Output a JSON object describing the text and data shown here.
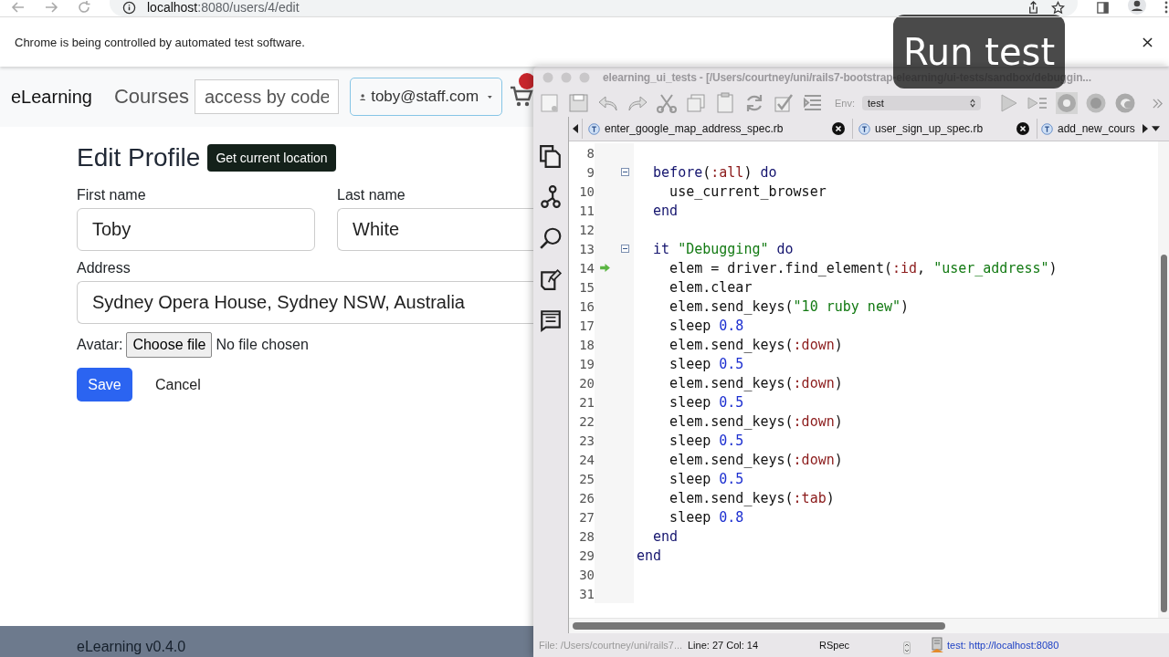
{
  "browser": {
    "url_host": "localhost",
    "url_rest": ":8080/users/4/edit",
    "infobar": "Chrome is being controlled by automated test software."
  },
  "site": {
    "brand": "eLearning",
    "nav_link": "Courses",
    "code_field": {
      "placeholder": "access by code"
    },
    "user_menu": "toby@staff.com"
  },
  "form": {
    "title": "Edit Profile",
    "location_button": "Get current location",
    "fields": [
      {
        "label": "First name",
        "value": "Toby"
      },
      {
        "label": "Last name",
        "value": "White"
      },
      {
        "label": "Address",
        "value": "Sydney Opera House, Sydney NSW, Australia"
      }
    ],
    "avatar_label": "Avatar:",
    "file_button": "Choose file",
    "file_status": "No file chosen",
    "save": "Save",
    "cancel": "Cancel"
  },
  "footer": "eLearning v0.4.0",
  "ide": {
    "title": "elearning_ui_tests - [/Users/courtney/uni/rails7-bootstrap-elearning/ui-tests/sandbox/debuggin...",
    "env_label": "Env:",
    "env_value": "test",
    "tabs": [
      {
        "label": "enter_google_map_address_spec.rb",
        "closable": true
      },
      {
        "label": "user_sign_up_spec.rb",
        "closable": true
      },
      {
        "label": "add_new_cours",
        "closable": false
      }
    ],
    "lines": [
      {
        "n": "8",
        "fold": false,
        "current": false
      },
      {
        "n": "9",
        "fold": true,
        "current": false,
        "tokens": [
          {
            "kind": "keyword",
            "text": "  before"
          },
          {
            "kind": "plain",
            "text": "("
          },
          {
            "kind": "symbol",
            "text": ":all"
          },
          {
            "kind": "plain",
            "text": ") "
          },
          {
            "kind": "keyword",
            "text": "do"
          }
        ]
      },
      {
        "n": "10",
        "fold": false,
        "current": false,
        "tokens": [
          {
            "kind": "plain",
            "text": "    use_current_browser"
          }
        ]
      },
      {
        "n": "11",
        "fold": false,
        "current": false,
        "tokens": [
          {
            "kind": "keyword",
            "text": "  end"
          }
        ]
      },
      {
        "n": "12",
        "fold": false,
        "current": false
      },
      {
        "n": "13",
        "fold": true,
        "current": false,
        "tokens": [
          {
            "kind": "keyword",
            "text": "  it"
          },
          {
            "kind": "string",
            "text": " \"Debugging\""
          },
          {
            "kind": "keyword",
            "text": " do"
          }
        ]
      },
      {
        "n": "14",
        "fold": false,
        "current": true,
        "tokens": [
          {
            "kind": "plain",
            "text": "    elem = driver.find_element("
          },
          {
            "kind": "symbol",
            "text": ":id"
          },
          {
            "kind": "plain",
            "text": ", "
          },
          {
            "kind": "string",
            "text": "\"user_address\""
          },
          {
            "kind": "plain",
            "text": ")"
          }
        ]
      },
      {
        "n": "15",
        "fold": false,
        "current": false,
        "tokens": [
          {
            "kind": "plain",
            "text": "    elem.clear"
          }
        ]
      },
      {
        "n": "16",
        "fold": false,
        "current": false,
        "tokens": [
          {
            "kind": "plain",
            "text": "    elem.send_keys("
          },
          {
            "kind": "string",
            "text": "\"10 ruby new\""
          },
          {
            "kind": "plain",
            "text": ")"
          }
        ]
      },
      {
        "n": "17",
        "fold": false,
        "current": false,
        "tokens": [
          {
            "kind": "plain",
            "text": "    sleep "
          },
          {
            "kind": "number",
            "text": "0.8"
          }
        ]
      },
      {
        "n": "18",
        "fold": false,
        "current": false,
        "tokens": [
          {
            "kind": "plain",
            "text": "    elem.send_keys("
          },
          {
            "kind": "symbol",
            "text": ":down"
          },
          {
            "kind": "plain",
            "text": ")"
          }
        ]
      },
      {
        "n": "19",
        "fold": false,
        "current": false,
        "tokens": [
          {
            "kind": "plain",
            "text": "    sleep "
          },
          {
            "kind": "number",
            "text": "0.5"
          }
        ]
      },
      {
        "n": "20",
        "fold": false,
        "current": false,
        "tokens": [
          {
            "kind": "plain",
            "text": "    elem.send_keys("
          },
          {
            "kind": "symbol",
            "text": ":down"
          },
          {
            "kind": "plain",
            "text": ")"
          }
        ]
      },
      {
        "n": "21",
        "fold": false,
        "current": false,
        "tokens": [
          {
            "kind": "plain",
            "text": "    sleep "
          },
          {
            "kind": "number",
            "text": "0.5"
          }
        ]
      },
      {
        "n": "22",
        "fold": false,
        "current": false,
        "tokens": [
          {
            "kind": "plain",
            "text": "    elem.send_keys("
          },
          {
            "kind": "symbol",
            "text": ":down"
          },
          {
            "kind": "plain",
            "text": ")"
          }
        ]
      },
      {
        "n": "23",
        "fold": false,
        "current": false,
        "tokens": [
          {
            "kind": "plain",
            "text": "    sleep "
          },
          {
            "kind": "number",
            "text": "0.5"
          }
        ]
      },
      {
        "n": "24",
        "fold": false,
        "current": false,
        "tokens": [
          {
            "kind": "plain",
            "text": "    elem.send_keys("
          },
          {
            "kind": "symbol",
            "text": ":down"
          },
          {
            "kind": "plain",
            "text": ")"
          }
        ]
      },
      {
        "n": "25",
        "fold": false,
        "current": false,
        "tokens": [
          {
            "kind": "plain",
            "text": "    sleep "
          },
          {
            "kind": "number",
            "text": "0.5"
          }
        ]
      },
      {
        "n": "26",
        "fold": false,
        "current": false,
        "tokens": [
          {
            "kind": "plain",
            "text": "    elem.send_keys("
          },
          {
            "kind": "symbol",
            "text": ":tab"
          },
          {
            "kind": "plain",
            "text": ")"
          }
        ]
      },
      {
        "n": "27",
        "fold": false,
        "current": false,
        "tokens": [
          {
            "kind": "plain",
            "text": "    sleep "
          },
          {
            "kind": "number",
            "text": "0.8"
          }
        ]
      },
      {
        "n": "28",
        "fold": false,
        "current": false,
        "tokens": [
          {
            "kind": "keyword",
            "text": "  end"
          }
        ]
      },
      {
        "n": "29",
        "fold": false,
        "current": false,
        "tokens": [
          {
            "kind": "keyword",
            "text": "end"
          }
        ]
      },
      {
        "n": "30",
        "fold": false,
        "current": false
      },
      {
        "n": "31",
        "fold": false,
        "current": false
      }
    ],
    "status": {
      "file": "File: /Users/courtney/uni/rails7...",
      "position": "Line: 27  Col: 14",
      "mode": "RSpec",
      "server": "test: http://localhost:8080"
    }
  },
  "caption": "Run test"
}
